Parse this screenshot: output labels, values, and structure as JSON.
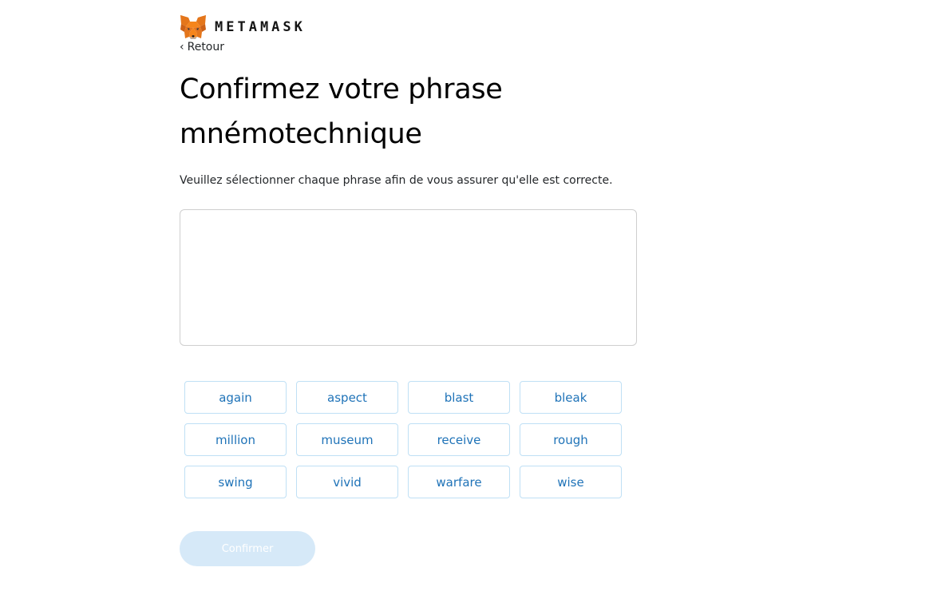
{
  "header": {
    "brand": "METAMASK",
    "logo_icon": "metamask-fox-icon",
    "back_label": "Retour",
    "back_icon": "chevron-left-icon"
  },
  "main": {
    "title": "Confirmez votre phrase mnémotechnique",
    "subtitle": "Veuillez sélectionner chaque phrase afin de vous assurer qu'elle est correcte.",
    "words": [
      "again",
      "aspect",
      "blast",
      "bleak",
      "million",
      "museum",
      "receive",
      "rough",
      "swing",
      "vivid",
      "warfare",
      "wise"
    ],
    "confirm_label": "Confirmer",
    "confirm_enabled": false
  },
  "colors": {
    "word_text": "#1f73b8",
    "word_border": "#bfe0f5",
    "confirm_disabled_bg": "#d6e9f8"
  }
}
